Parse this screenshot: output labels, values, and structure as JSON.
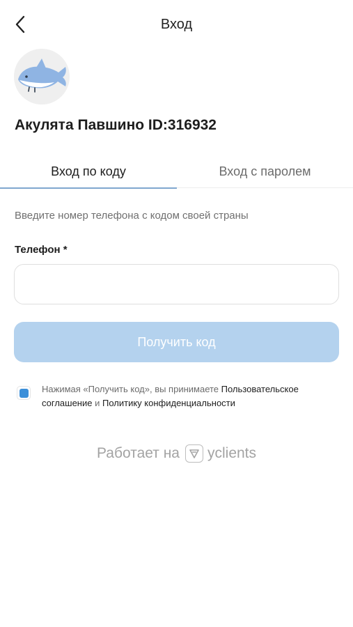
{
  "header": {
    "title": "Вход",
    "back_icon": "chevron-left-icon"
  },
  "company": {
    "name": "Акулята Павшино ID:316932",
    "avatar_icon": "shark-logo",
    "avatar_color": "#8fb4e3"
  },
  "tabs": [
    {
      "label": "Вход по коду",
      "active": true
    },
    {
      "label": "Вход с паролем",
      "active": false
    }
  ],
  "form": {
    "hint": "Введите номер телефона с кодом своей страны",
    "phone_label": "Телефон *",
    "phone_value": "",
    "submit_label": "Получить код",
    "submit_color": "#b4d2ee"
  },
  "consent": {
    "checked": true,
    "text_prefix": "Нажимая «Получить код», вы принимаете ",
    "link_agreement": "Пользовательское соглашение",
    "text_and": " и ",
    "link_privacy": "Политику конфиденциальности",
    "accent_color": "#3b8fd9"
  },
  "footer": {
    "powered_text": "Работает на",
    "brand": "yclients",
    "brand_icon": "yclients-logo-icon"
  }
}
